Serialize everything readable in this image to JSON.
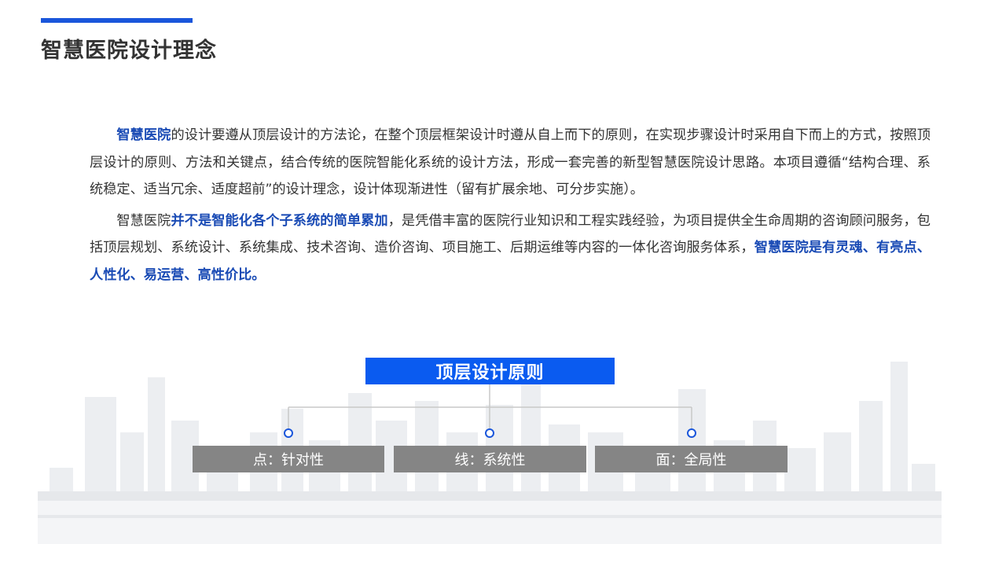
{
  "header": {
    "title": "智慧医院设计理念"
  },
  "content": {
    "paragraph1": [
      {
        "text": "智慧医院",
        "highlight": true
      },
      {
        "text": "的设计要遵从顶层设计的方法论，在整个顶层框架设计时遵从自上而下的原则，在实现步骤设计时采用自下而上的方式，按照顶层设计的原则、方法和关键点，结合传统的医院智能化系统的设计方法，形成一套完善的新型智慧医院设计思路。本项目遵循“结构合理、系统稳定、适当冗余、适度超前”的设计理念，设计体现渐进性（留有扩展余地、可分步实施）。",
        "highlight": false
      }
    ],
    "paragraph2": [
      {
        "text": "智慧医院",
        "highlight": false
      },
      {
        "text": "并不是智能化各个子系统的简单累加",
        "highlight": true
      },
      {
        "text": "，是凭借丰富的医院行业知识和工程实践经验，为项目提供全生命周期的咨询顾问服务，包括顶层规划、系统设计、系统集成、技术咨询、造价咨询、项目施工、后期运维等内容的一体化咨询服务体系，",
        "highlight": false
      },
      {
        "text": "智慧医院是有灵魂、有亮点、人性化、易运营、高性价比。",
        "highlight": true
      }
    ]
  },
  "diagram": {
    "title": "顶层设计原则",
    "principles": [
      "点：针对性",
      "线：系统性",
      "面：全局性"
    ]
  },
  "colors": {
    "accent": "#1a56db",
    "highlight_text": "#1a4bb5",
    "diagram_title_bg": "#0a5bf0",
    "box_bg": "#858585",
    "connector_line": "#c8c8c8",
    "node_ring": "#1a56db"
  }
}
